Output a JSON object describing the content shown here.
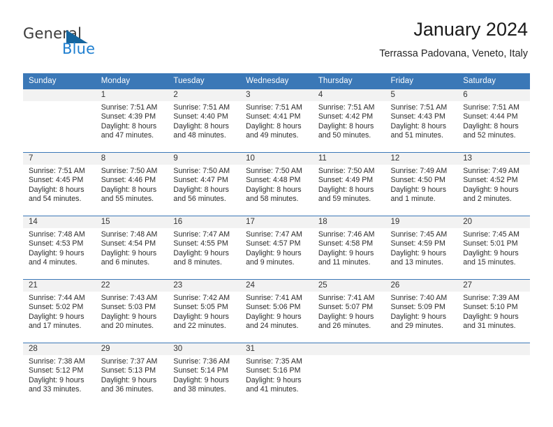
{
  "brand": {
    "name_part1": "General",
    "name_part2": "Blue",
    "triangle_color": "#15659e",
    "blue": "#1f7fd0"
  },
  "header": {
    "title": "January 2024",
    "subtitle": "Terrassa Padovana, Veneto, Italy"
  },
  "theme": {
    "header_row_bg": "#3b78b7",
    "header_row_text": "#ffffff",
    "daynum_band_bg": "#f2f2f2",
    "body_text": "#2b2b2b"
  },
  "weekdays": [
    "Sunday",
    "Monday",
    "Tuesday",
    "Wednesday",
    "Thursday",
    "Friday",
    "Saturday"
  ],
  "labels": {
    "sunrise": "Sunrise:",
    "sunset": "Sunset:",
    "daylight": "Daylight:"
  },
  "weeks": [
    [
      {
        "day": "",
        "sunrise": "",
        "sunset": "",
        "daylight1": "",
        "daylight2": ""
      },
      {
        "day": "1",
        "sunrise": "Sunrise: 7:51 AM",
        "sunset": "Sunset: 4:39 PM",
        "daylight1": "Daylight: 8 hours",
        "daylight2": "and 47 minutes."
      },
      {
        "day": "2",
        "sunrise": "Sunrise: 7:51 AM",
        "sunset": "Sunset: 4:40 PM",
        "daylight1": "Daylight: 8 hours",
        "daylight2": "and 48 minutes."
      },
      {
        "day": "3",
        "sunrise": "Sunrise: 7:51 AM",
        "sunset": "Sunset: 4:41 PM",
        "daylight1": "Daylight: 8 hours",
        "daylight2": "and 49 minutes."
      },
      {
        "day": "4",
        "sunrise": "Sunrise: 7:51 AM",
        "sunset": "Sunset: 4:42 PM",
        "daylight1": "Daylight: 8 hours",
        "daylight2": "and 50 minutes."
      },
      {
        "day": "5",
        "sunrise": "Sunrise: 7:51 AM",
        "sunset": "Sunset: 4:43 PM",
        "daylight1": "Daylight: 8 hours",
        "daylight2": "and 51 minutes."
      },
      {
        "day": "6",
        "sunrise": "Sunrise: 7:51 AM",
        "sunset": "Sunset: 4:44 PM",
        "daylight1": "Daylight: 8 hours",
        "daylight2": "and 52 minutes."
      }
    ],
    [
      {
        "day": "7",
        "sunrise": "Sunrise: 7:51 AM",
        "sunset": "Sunset: 4:45 PM",
        "daylight1": "Daylight: 8 hours",
        "daylight2": "and 54 minutes."
      },
      {
        "day": "8",
        "sunrise": "Sunrise: 7:50 AM",
        "sunset": "Sunset: 4:46 PM",
        "daylight1": "Daylight: 8 hours",
        "daylight2": "and 55 minutes."
      },
      {
        "day": "9",
        "sunrise": "Sunrise: 7:50 AM",
        "sunset": "Sunset: 4:47 PM",
        "daylight1": "Daylight: 8 hours",
        "daylight2": "and 56 minutes."
      },
      {
        "day": "10",
        "sunrise": "Sunrise: 7:50 AM",
        "sunset": "Sunset: 4:48 PM",
        "daylight1": "Daylight: 8 hours",
        "daylight2": "and 58 minutes."
      },
      {
        "day": "11",
        "sunrise": "Sunrise: 7:50 AM",
        "sunset": "Sunset: 4:49 PM",
        "daylight1": "Daylight: 8 hours",
        "daylight2": "and 59 minutes."
      },
      {
        "day": "12",
        "sunrise": "Sunrise: 7:49 AM",
        "sunset": "Sunset: 4:50 PM",
        "daylight1": "Daylight: 9 hours",
        "daylight2": "and 1 minute."
      },
      {
        "day": "13",
        "sunrise": "Sunrise: 7:49 AM",
        "sunset": "Sunset: 4:52 PM",
        "daylight1": "Daylight: 9 hours",
        "daylight2": "and 2 minutes."
      }
    ],
    [
      {
        "day": "14",
        "sunrise": "Sunrise: 7:48 AM",
        "sunset": "Sunset: 4:53 PM",
        "daylight1": "Daylight: 9 hours",
        "daylight2": "and 4 minutes."
      },
      {
        "day": "15",
        "sunrise": "Sunrise: 7:48 AM",
        "sunset": "Sunset: 4:54 PM",
        "daylight1": "Daylight: 9 hours",
        "daylight2": "and 6 minutes."
      },
      {
        "day": "16",
        "sunrise": "Sunrise: 7:47 AM",
        "sunset": "Sunset: 4:55 PM",
        "daylight1": "Daylight: 9 hours",
        "daylight2": "and 8 minutes."
      },
      {
        "day": "17",
        "sunrise": "Sunrise: 7:47 AM",
        "sunset": "Sunset: 4:57 PM",
        "daylight1": "Daylight: 9 hours",
        "daylight2": "and 9 minutes."
      },
      {
        "day": "18",
        "sunrise": "Sunrise: 7:46 AM",
        "sunset": "Sunset: 4:58 PM",
        "daylight1": "Daylight: 9 hours",
        "daylight2": "and 11 minutes."
      },
      {
        "day": "19",
        "sunrise": "Sunrise: 7:45 AM",
        "sunset": "Sunset: 4:59 PM",
        "daylight1": "Daylight: 9 hours",
        "daylight2": "and 13 minutes."
      },
      {
        "day": "20",
        "sunrise": "Sunrise: 7:45 AM",
        "sunset": "Sunset: 5:01 PM",
        "daylight1": "Daylight: 9 hours",
        "daylight2": "and 15 minutes."
      }
    ],
    [
      {
        "day": "21",
        "sunrise": "Sunrise: 7:44 AM",
        "sunset": "Sunset: 5:02 PM",
        "daylight1": "Daylight: 9 hours",
        "daylight2": "and 17 minutes."
      },
      {
        "day": "22",
        "sunrise": "Sunrise: 7:43 AM",
        "sunset": "Sunset: 5:03 PM",
        "daylight1": "Daylight: 9 hours",
        "daylight2": "and 20 minutes."
      },
      {
        "day": "23",
        "sunrise": "Sunrise: 7:42 AM",
        "sunset": "Sunset: 5:05 PM",
        "daylight1": "Daylight: 9 hours",
        "daylight2": "and 22 minutes."
      },
      {
        "day": "24",
        "sunrise": "Sunrise: 7:41 AM",
        "sunset": "Sunset: 5:06 PM",
        "daylight1": "Daylight: 9 hours",
        "daylight2": "and 24 minutes."
      },
      {
        "day": "25",
        "sunrise": "Sunrise: 7:41 AM",
        "sunset": "Sunset: 5:07 PM",
        "daylight1": "Daylight: 9 hours",
        "daylight2": "and 26 minutes."
      },
      {
        "day": "26",
        "sunrise": "Sunrise: 7:40 AM",
        "sunset": "Sunset: 5:09 PM",
        "daylight1": "Daylight: 9 hours",
        "daylight2": "and 29 minutes."
      },
      {
        "day": "27",
        "sunrise": "Sunrise: 7:39 AM",
        "sunset": "Sunset: 5:10 PM",
        "daylight1": "Daylight: 9 hours",
        "daylight2": "and 31 minutes."
      }
    ],
    [
      {
        "day": "28",
        "sunrise": "Sunrise: 7:38 AM",
        "sunset": "Sunset: 5:12 PM",
        "daylight1": "Daylight: 9 hours",
        "daylight2": "and 33 minutes."
      },
      {
        "day": "29",
        "sunrise": "Sunrise: 7:37 AM",
        "sunset": "Sunset: 5:13 PM",
        "daylight1": "Daylight: 9 hours",
        "daylight2": "and 36 minutes."
      },
      {
        "day": "30",
        "sunrise": "Sunrise: 7:36 AM",
        "sunset": "Sunset: 5:14 PM",
        "daylight1": "Daylight: 9 hours",
        "daylight2": "and 38 minutes."
      },
      {
        "day": "31",
        "sunrise": "Sunrise: 7:35 AM",
        "sunset": "Sunset: 5:16 PM",
        "daylight1": "Daylight: 9 hours",
        "daylight2": "and 41 minutes."
      },
      {
        "day": "",
        "sunrise": "",
        "sunset": "",
        "daylight1": "",
        "daylight2": ""
      },
      {
        "day": "",
        "sunrise": "",
        "sunset": "",
        "daylight1": "",
        "daylight2": ""
      },
      {
        "day": "",
        "sunrise": "",
        "sunset": "",
        "daylight1": "",
        "daylight2": ""
      }
    ]
  ]
}
